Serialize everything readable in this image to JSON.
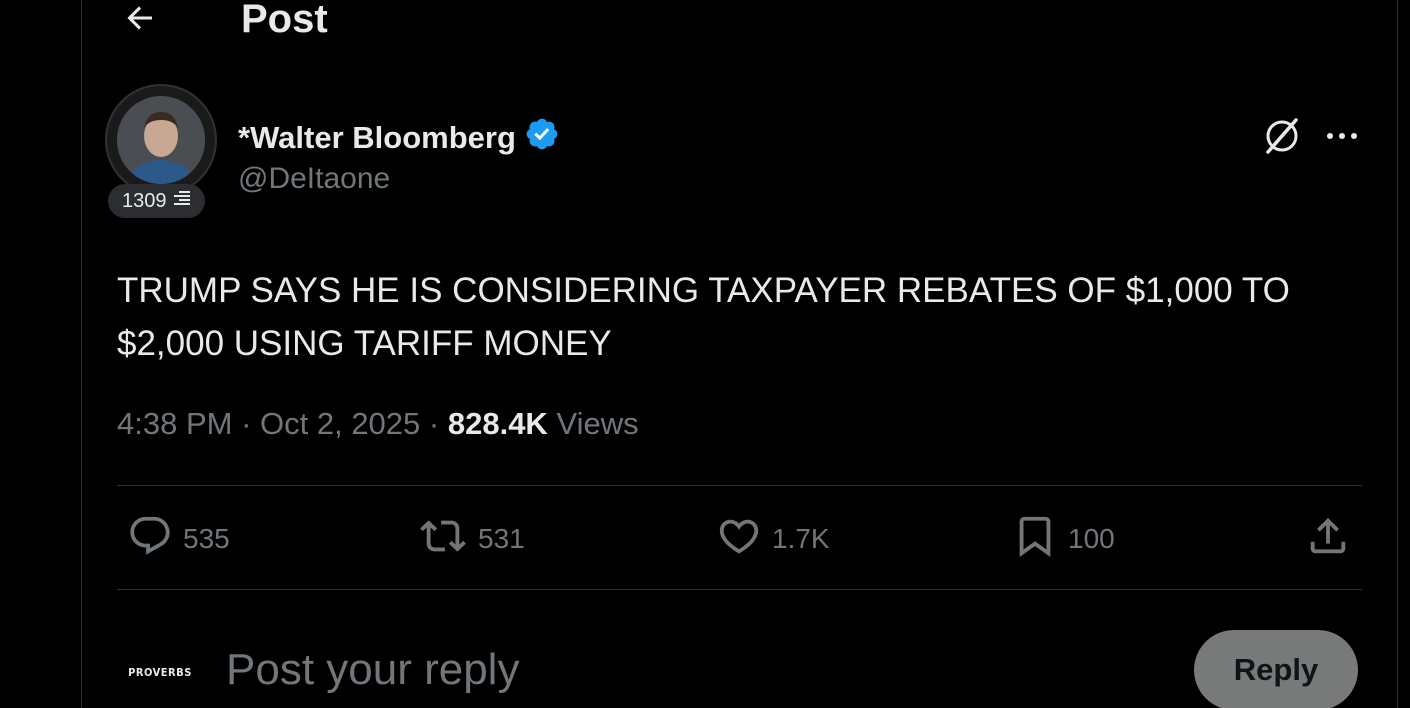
{
  "header": {
    "title": "Post",
    "back_icon": "arrow-left-icon"
  },
  "author": {
    "display_name": "*Walter Bloomberg",
    "handle": "@DeItaone",
    "verified": true,
    "verified_color": "#1d9bf0",
    "level_badge": "1309"
  },
  "tweet": {
    "text": "TRUMP SAYS HE IS CONSIDERING TAXPAYER REBATES OF $1,000 TO $2,000 USING TARIFF MONEY",
    "time": "4:38 PM",
    "date": "Oct 2, 2025",
    "views_count": "828.4K",
    "views_label": "Views"
  },
  "actions": {
    "replies": "535",
    "reposts": "531",
    "likes": "1.7K",
    "bookmarks": "100"
  },
  "reply_box": {
    "avatar_text": "PROVERBS",
    "placeholder": "Post your reply",
    "button_label": "Reply"
  },
  "colors": {
    "background": "#000000",
    "text_primary": "#e7e9ea",
    "text_secondary": "#71767b",
    "divider": "#2f3336",
    "reply_button_bg": "#787a7a"
  }
}
